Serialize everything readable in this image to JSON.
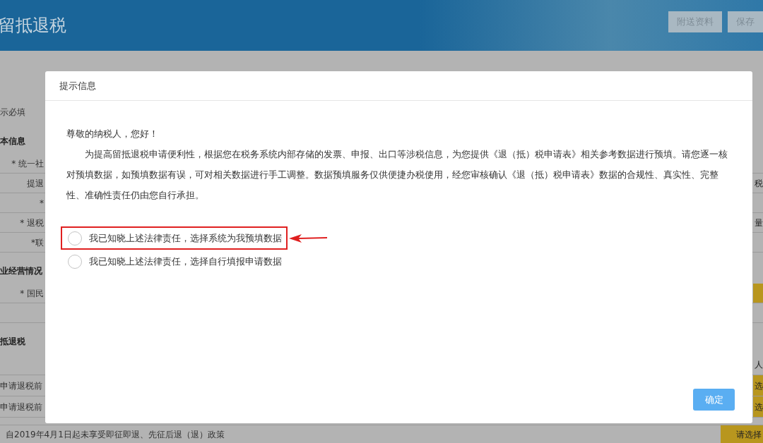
{
  "header": {
    "title": "留抵退税",
    "buttons": [
      "附送资料",
      "保存"
    ]
  },
  "background": {
    "rows": [
      {
        "kind": "note",
        "left": "示必填"
      },
      {
        "kind": "section",
        "left": "本信息"
      },
      {
        "kind": "field",
        "left": "* 统一社"
      },
      {
        "kind": "field",
        "left": "提退",
        "right": "税",
        "right_filled": false
      },
      {
        "kind": "field",
        "left": "*"
      },
      {
        "kind": "field",
        "left": "* 退税",
        "right": "量",
        "right_filled": false
      },
      {
        "kind": "field",
        "left": "*联"
      },
      {
        "kind": "section",
        "left": "业经营情况"
      },
      {
        "kind": "field",
        "left": "* 国民",
        "right": "",
        "right_filled": true
      },
      {
        "kind": "field",
        "left": ""
      },
      {
        "kind": "section",
        "left": "抵退税"
      },
      {
        "kind": "table",
        "left": "",
        "right": "人",
        "right_filled": false
      },
      {
        "kind": "table",
        "left": "申请退税前",
        "right": "选",
        "right_filled": true
      },
      {
        "kind": "table",
        "left": "申请退税前",
        "right": "选",
        "right_filled": true
      },
      {
        "kind": "footer",
        "left": "自2019年4月1日起未享受即征即退、先征后退（退）政策",
        "right": "请选择",
        "right_filled": true
      }
    ]
  },
  "dialog": {
    "title": "提示信息",
    "greeting": "尊敬的纳税人，您好！",
    "body": "为提高留抵退税申请便利性，根据您在税务系统内部存储的发票、申报、出口等涉税信息，为您提供《退（抵）税申请表》相关参考数据进行预填。请您逐一核对预填数据，如预填数据有误，可对相关数据进行手工调整。数据预填服务仅供便捷办税使用，经您审核确认《退（抵）税申请表》数据的合规性、真实性、完整性、准确性责任仍由您自行承担。",
    "options": [
      {
        "label": "我已知晓上述法律责任，选择系统为我预填数据",
        "selected": false,
        "highlighted": true
      },
      {
        "label": "我已知晓上述法律责任，选择自行填报申请数据",
        "selected": false,
        "highlighted": false
      }
    ],
    "confirm": "确定"
  }
}
